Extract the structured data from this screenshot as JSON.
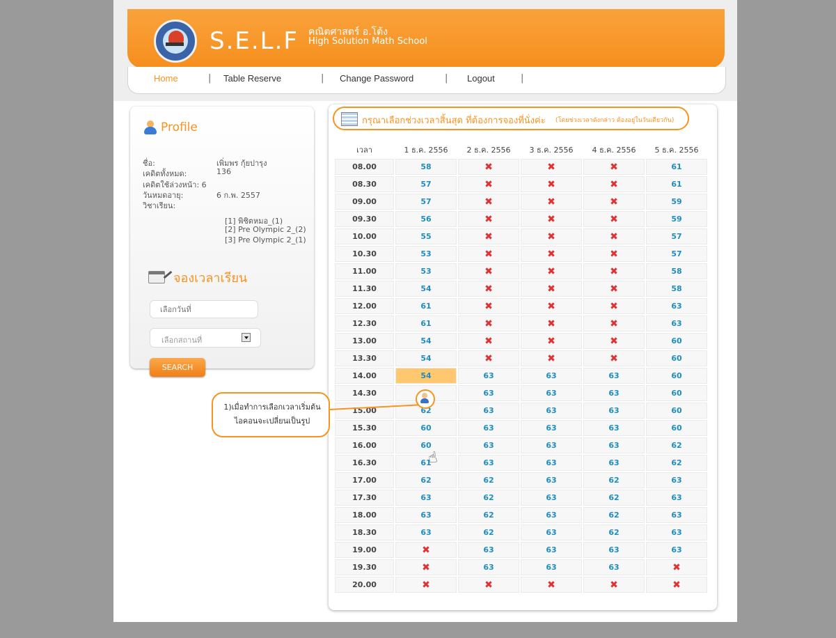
{
  "brand": {
    "name": "S.E.L.F",
    "name_th": "คณิตศาสตร์ อ.โต้ง",
    "tagline": "High Solution Math School"
  },
  "nav": {
    "items": [
      "Home",
      "Table Reserve",
      "Change Password",
      "Logout"
    ],
    "separator": "|",
    "active": "Home",
    "active_color": "#f7931e"
  },
  "profile": {
    "title": "Profile",
    "rows": [
      {
        "label": "ชื่อ:",
        "value": "เพิ่มพร กุ้ยปารุง"
      },
      {
        "label": "เคดิตทั้งหมด:",
        "value": "136"
      },
      {
        "label": "เคดิตใช้ล่วงหน้า: 6",
        "value": ""
      },
      {
        "label": "วันหมดอายุ:",
        "value": "6 ก.พ. 2557"
      },
      {
        "label": "วิชาเรียน:",
        "value": ""
      }
    ],
    "subjects": [
      "[1] พิชิตหมอ_(1)",
      "[2] Pre Olympic 2_(2)",
      "[3] Pre Olympic 2_(1)"
    ]
  },
  "reserve": {
    "title": "จองเวลาเรียน",
    "date_placeholder": "เลือกวันที่",
    "place_placeholder": "เลือกสถานที่",
    "search_label": "SEARCH"
  },
  "table": {
    "heading": "กรุณาเลือกช่วงเวลาสิ้นสุด ที่ต้องการจองที่นั่งค่ะ",
    "note": "(โดยช่วงเวลาดังกล่าว ต้องอยู่ในวันเดียวกัน)",
    "columns": [
      "เวลา",
      "1 ธ.ค. 2556",
      "2 ธ.ค. 2556",
      "3 ธ.ค. 2556",
      "4 ธ.ค. 2556",
      "5 ธ.ค. 2556"
    ],
    "x_mark": "✖",
    "rows": [
      {
        "time": "08.00",
        "cells": [
          "58",
          "x",
          "x",
          "x",
          "61"
        ]
      },
      {
        "time": "08.30",
        "cells": [
          "57",
          "x",
          "x",
          "x",
          "61"
        ]
      },
      {
        "time": "09.00",
        "cells": [
          "57",
          "x",
          "x",
          "x",
          "59"
        ]
      },
      {
        "time": "09.30",
        "cells": [
          "56",
          "x",
          "x",
          "x",
          "59"
        ]
      },
      {
        "time": "10.00",
        "cells": [
          "55",
          "x",
          "x",
          "x",
          "57"
        ]
      },
      {
        "time": "10.30",
        "cells": [
          "53",
          "x",
          "x",
          "x",
          "57"
        ]
      },
      {
        "time": "11.00",
        "cells": [
          "53",
          "x",
          "x",
          "x",
          "58"
        ]
      },
      {
        "time": "11.30",
        "cells": [
          "54",
          "x",
          "x",
          "x",
          "58"
        ]
      },
      {
        "time": "12.00",
        "cells": [
          "61",
          "x",
          "x",
          "x",
          "63"
        ]
      },
      {
        "time": "12.30",
        "cells": [
          "61",
          "x",
          "x",
          "x",
          "63"
        ]
      },
      {
        "time": "13.00",
        "cells": [
          "54",
          "x",
          "x",
          "x",
          "60"
        ]
      },
      {
        "time": "13.30",
        "cells": [
          "54",
          "x",
          "x",
          "x",
          "60"
        ]
      },
      {
        "time": "14.00",
        "cells": [
          "54",
          "63",
          "63",
          "63",
          "60"
        ],
        "selected": 0
      },
      {
        "time": "14.30",
        "cells": [
          "user",
          "63",
          "63",
          "63",
          "60"
        ]
      },
      {
        "time": "15.00",
        "cells": [
          "62",
          "63",
          "63",
          "63",
          "60"
        ]
      },
      {
        "time": "15.30",
        "cells": [
          "60",
          "63",
          "63",
          "63",
          "60"
        ]
      },
      {
        "time": "16.00",
        "cells": [
          "60",
          "63",
          "63",
          "63",
          "62"
        ]
      },
      {
        "time": "16.30",
        "cells": [
          "61",
          "63",
          "63",
          "63",
          "62"
        ]
      },
      {
        "time": "17.00",
        "cells": [
          "62",
          "62",
          "63",
          "62",
          "63"
        ]
      },
      {
        "time": "17.30",
        "cells": [
          "63",
          "62",
          "63",
          "62",
          "63"
        ]
      },
      {
        "time": "18.00",
        "cells": [
          "63",
          "62",
          "63",
          "62",
          "63"
        ]
      },
      {
        "time": "18.30",
        "cells": [
          "63",
          "62",
          "63",
          "62",
          "63"
        ]
      },
      {
        "time": "19.00",
        "cells": [
          "x",
          "63",
          "63",
          "63",
          "63"
        ]
      },
      {
        "time": "19.30",
        "cells": [
          "x",
          "63",
          "63",
          "63",
          "x"
        ]
      },
      {
        "time": "20.00",
        "cells": [
          "x",
          "x",
          "x",
          "x",
          "x"
        ]
      }
    ]
  },
  "callout": {
    "text": "1)เมื่อทำการเลือกเวลาเริ่มต้น ไอคอนจะเปลี่ยนเป็นรูป"
  },
  "icons": [
    "logo-emblem",
    "user-icon",
    "calendar-icon",
    "pencil-icon",
    "schedule-icon",
    "dropdown-icon",
    "hand-cursor-icon"
  ],
  "colors": {
    "accent": "#f7931e",
    "value": "#1f8dc0",
    "unavailable": "#e03232",
    "selected": "#ffc870"
  }
}
